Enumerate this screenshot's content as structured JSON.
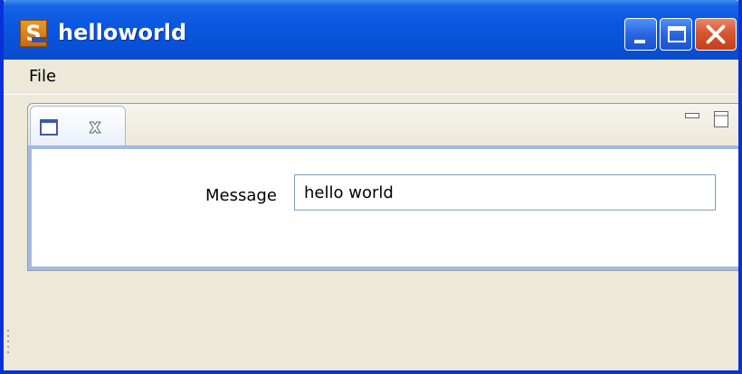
{
  "window": {
    "title": "helloworld",
    "app_icon_letter": "S",
    "controls": {
      "minimize_icon": "minimize-icon",
      "maximize_icon": "maximize-icon",
      "close_icon": "close-icon"
    },
    "colors": {
      "titlebar": "#0a58e0",
      "close_button": "#d7552f",
      "frame": "#0831d9",
      "background": "#ece9d8"
    }
  },
  "menubar": {
    "items": [
      {
        "label": "File"
      }
    ]
  },
  "view": {
    "tab_icon": "view-icon",
    "tab_close_icon": "close-icon",
    "toolbar": {
      "minimize_icon": "view-minimize-icon",
      "maximize_icon": "view-maximize-icon"
    },
    "form": {
      "message_label": "Message",
      "message_value": "hello world"
    },
    "colors": {
      "content_border": "#a2b9e2",
      "input_border": "#7f9db9"
    }
  },
  "statusbar": {
    "grip_icon": "resize-grip-icon"
  }
}
